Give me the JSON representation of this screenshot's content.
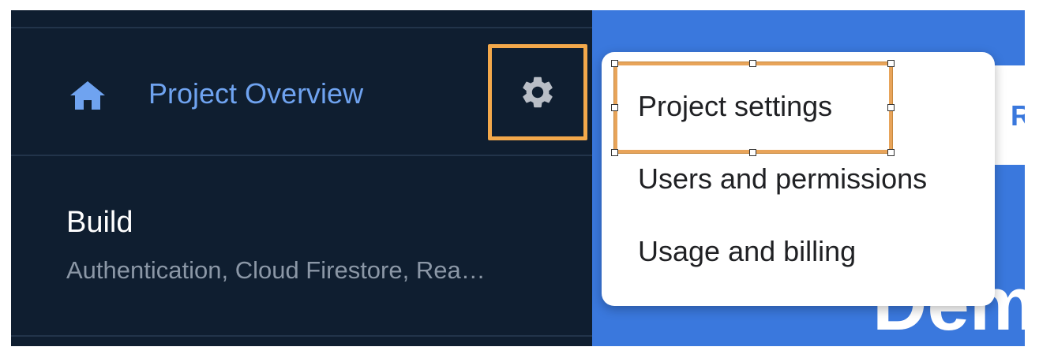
{
  "sidebar": {
    "project_overview_label": "Project Overview",
    "home_icon": "home-icon",
    "settings_icon": "gear-icon",
    "build": {
      "title": "Build",
      "subtitle": "Authentication, Cloud Firestore, Rea…"
    }
  },
  "menu": {
    "items": [
      {
        "label": "Project settings"
      },
      {
        "label": "Users and permissions"
      },
      {
        "label": "Usage and billing"
      }
    ]
  },
  "main": {
    "card_letter": "R",
    "big_text": "Dem"
  },
  "colors": {
    "sidebar_bg": "#0f1e30",
    "accent_blue": "#6fa3f0",
    "main_bg": "#3a78dd",
    "highlight": "#f2a84b"
  }
}
